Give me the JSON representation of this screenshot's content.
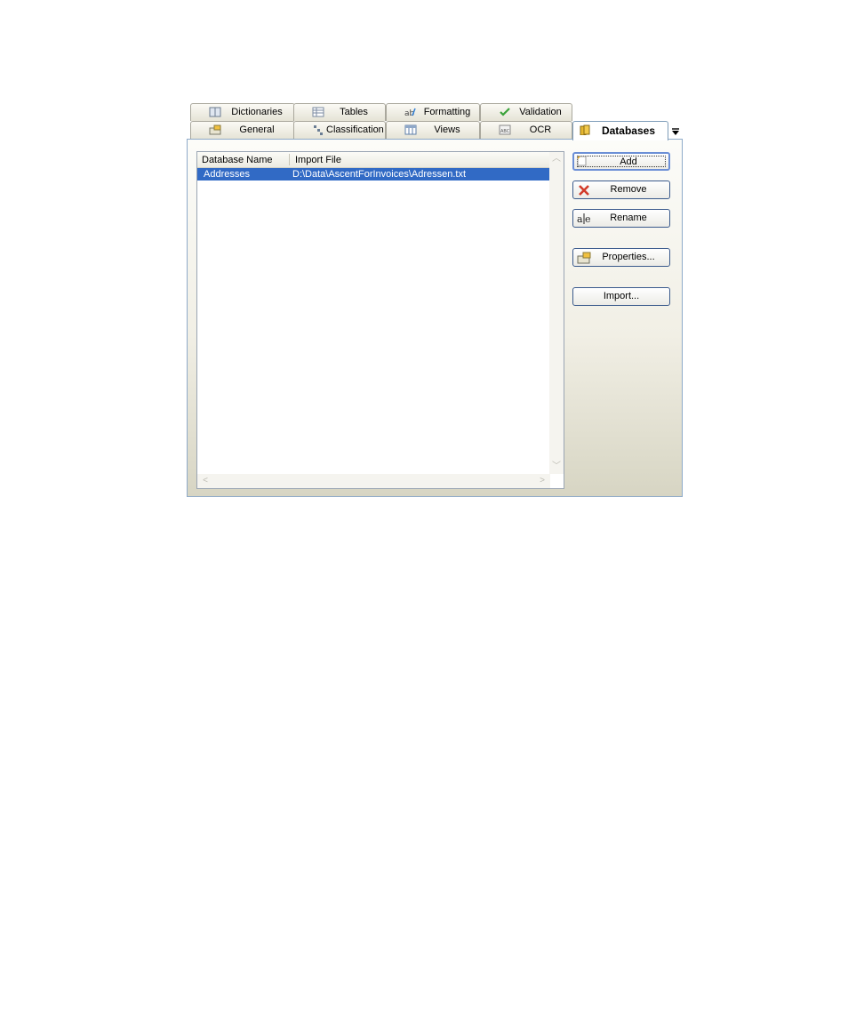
{
  "tabs_row1": [
    {
      "label": "Dictionaries",
      "icon": "book-icon"
    },
    {
      "label": "Tables",
      "icon": "table-icon"
    },
    {
      "label": "Formatting",
      "icon": "spelling-icon"
    },
    {
      "label": "Validation",
      "icon": "checkmark-icon"
    }
  ],
  "tabs_row2": [
    {
      "label": "General",
      "icon": "properties-icon"
    },
    {
      "label": "Classification",
      "icon": "tree-icon"
    },
    {
      "label": "Views",
      "icon": "grid-icon"
    },
    {
      "label": "OCR",
      "icon": "abc-icon"
    },
    {
      "label": "Databases",
      "icon": "database-icon",
      "selected": true
    }
  ],
  "list": {
    "columns": [
      "Database Name",
      "Import File"
    ],
    "rows": [
      {
        "name": "Addresses",
        "file": "D:\\Data\\AscentForInvoices\\Adressen.txt",
        "selected": true
      }
    ]
  },
  "buttons": {
    "add": "Add",
    "remove": "Remove",
    "rename": "Rename",
    "properties": "Properties...",
    "import": "Import..."
  },
  "colors": {
    "selection": "#316ac5",
    "panel_border": "#8eaac9"
  }
}
